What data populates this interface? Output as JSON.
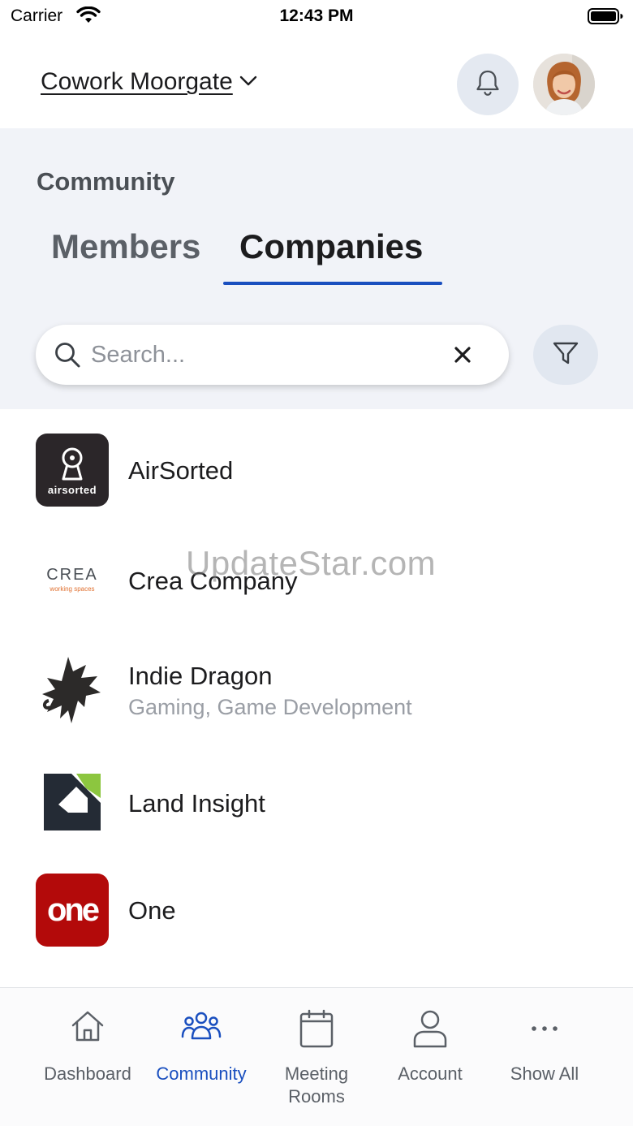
{
  "status_bar": {
    "carrier": "Carrier",
    "time": "12:43 PM"
  },
  "header": {
    "location": "Cowork Moorgate",
    "icons": [
      "chevron-down-icon",
      "bell-icon",
      "avatar"
    ]
  },
  "community": {
    "title": "Community",
    "tabs": [
      {
        "label": "Members",
        "active": false
      },
      {
        "label": "Companies",
        "active": true
      }
    ],
    "search": {
      "placeholder": "Search...",
      "value": ""
    }
  },
  "companies": [
    {
      "name": "AirSorted",
      "subtitle": "",
      "logo_text": "airsorted",
      "logo_icon": "keyhole-icon"
    },
    {
      "name": "Crea Company",
      "subtitle": "",
      "logo_text": "CREA",
      "logo_subtext": "working spaces"
    },
    {
      "name": "Indie Dragon",
      "subtitle": "Gaming, Game Development",
      "logo_icon": "dragon-icon"
    },
    {
      "name": "Land Insight",
      "subtitle": "",
      "logo_icon": "land-insight-logo"
    },
    {
      "name": "One",
      "subtitle": "",
      "logo_text": "one"
    }
  ],
  "watermark": "UpdateStar.com",
  "bottom_nav": [
    {
      "label": "Dashboard",
      "icon": "home-icon",
      "active": false
    },
    {
      "label": "Community",
      "icon": "people-icon",
      "active": true
    },
    {
      "label": "Meeting\nRooms",
      "icon": "calendar-icon",
      "active": false
    },
    {
      "label": "Account",
      "icon": "user-icon",
      "active": false
    },
    {
      "label": "Show All",
      "icon": "more-icon",
      "active": false
    }
  ],
  "colors": {
    "accent": "#1a4fbf",
    "panel_bg": "#f1f3f8",
    "one_red": "#b30a0a",
    "airsorted_bg": "#2b2629",
    "land_green": "#8cc63f",
    "land_dark": "#242b35"
  }
}
